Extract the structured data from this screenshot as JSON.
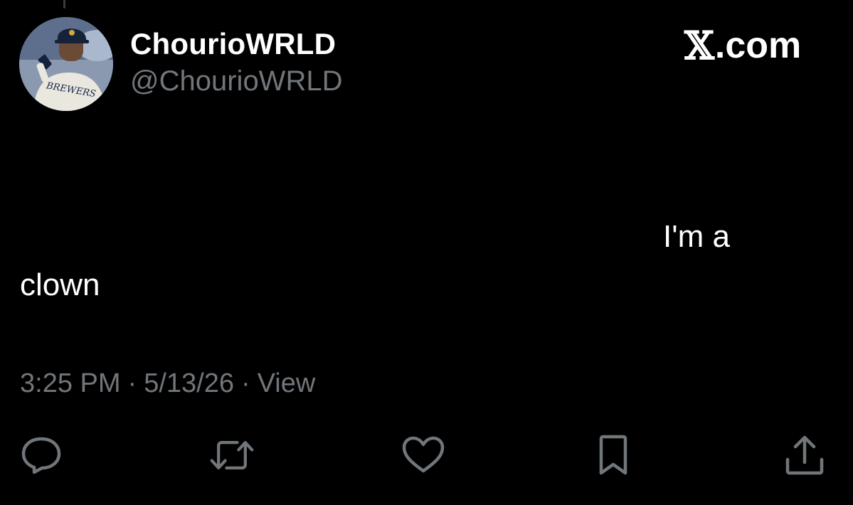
{
  "tweet": {
    "display_name": "ChourioWRLD",
    "handle": "@ChourioWRLD",
    "text_line1": "I'm a",
    "text_line2": "clown",
    "time": "3:25 PM",
    "date": "5/13/26",
    "views_label": "View",
    "separator": "·"
  },
  "brand": {
    "logo_glyph": "𝕏",
    "label": ".com"
  },
  "avatar": {
    "jersey_text": "BREWERS"
  },
  "actions": [
    {
      "name": "reply",
      "icon": "reply-icon"
    },
    {
      "name": "repost",
      "icon": "repost-icon"
    },
    {
      "name": "like",
      "icon": "heart-icon"
    },
    {
      "name": "bookmark",
      "icon": "bookmark-icon"
    },
    {
      "name": "share",
      "icon": "share-icon"
    }
  ],
  "colors": {
    "background": "#000000",
    "primary_text": "#ffffff",
    "secondary_text": "#71767b"
  }
}
